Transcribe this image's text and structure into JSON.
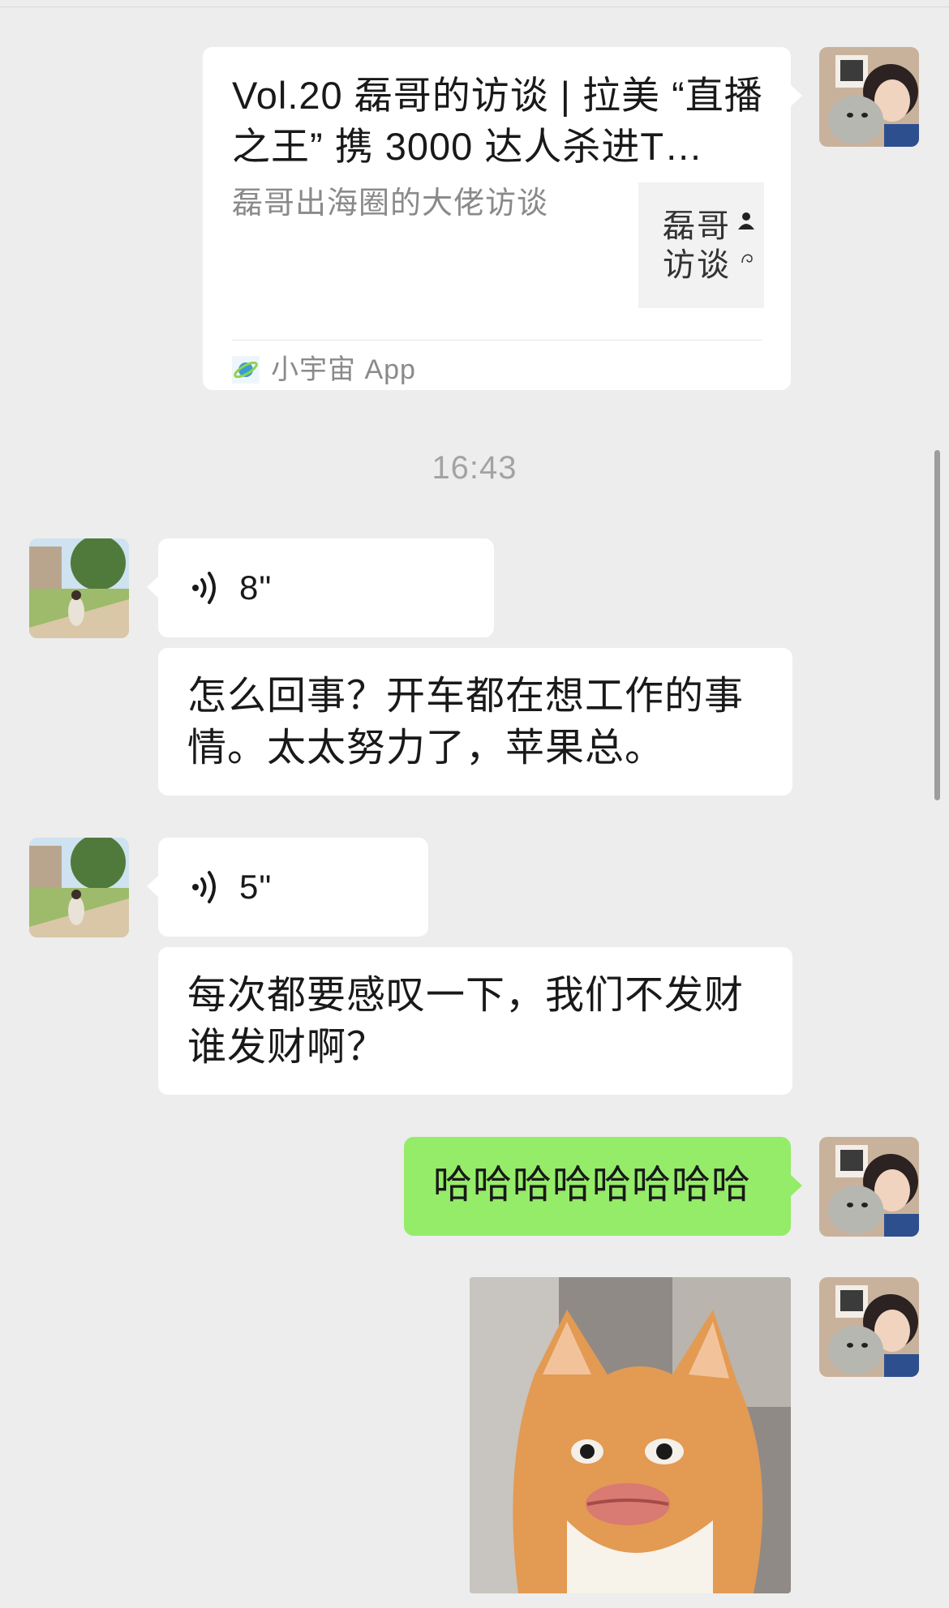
{
  "link_card": {
    "title": "Vol.20 磊哥的访谈 | 拉美 “直播之王” 携 3000 达人杀进T…",
    "description": "磊哥出海圈的大佬访谈",
    "thumbnail_line1": "磊哥",
    "thumbnail_line2": "访谈",
    "source": "小宇宙 App",
    "source_icon": "planet-icon"
  },
  "timestamp": "16:43",
  "messages": [
    {
      "type": "voice",
      "duration": "8\"",
      "icon": "voice-wave-icon"
    },
    {
      "type": "text",
      "text": "怎么回事？开车都在想工作的事情。太太努力了，苹果总。"
    },
    {
      "type": "voice",
      "duration": "5\"",
      "icon": "voice-wave-icon"
    },
    {
      "type": "text",
      "text": "每次都要感叹一下，我们不发财谁发财啊？"
    },
    {
      "type": "text",
      "text": "哈哈哈哈哈哈哈哈"
    }
  ],
  "colors": {
    "background": "#ededed",
    "bubble_received": "#ffffff",
    "bubble_sent": "#95ec69",
    "muted_text": "#8a8a8a"
  }
}
